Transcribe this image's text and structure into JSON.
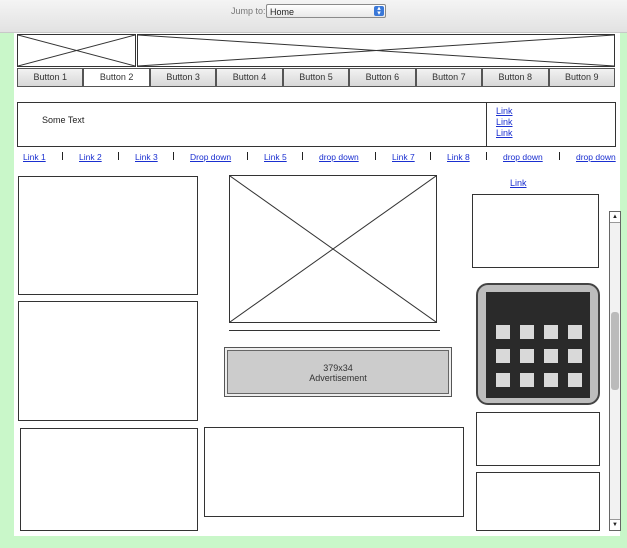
{
  "toolbar": {
    "label": "Jump to:",
    "select_value": "Home"
  },
  "nav_buttons": [
    "Button 1",
    "Button 2",
    "Button 3",
    "Button 4",
    "Button 5",
    "Button 6",
    "Button 7",
    "Button 8",
    "Button 9"
  ],
  "active_button": "Button 2",
  "info_bar": {
    "text": "Some Text",
    "links": [
      "Link",
      "Link",
      "Link"
    ]
  },
  "link_row": [
    "Link 1",
    "Link 2",
    "Link 3",
    "Drop down",
    "Link 5",
    "drop down",
    "Link 7",
    "Link 8",
    "drop down",
    "drop down"
  ],
  "right_column": {
    "link": "Link"
  },
  "advertisement": {
    "size": "379x34",
    "label": "Advertisement"
  },
  "icons": [
    "image-placeholder-icon",
    "calculator-icon",
    "scroll-up-icon",
    "scroll-down-icon",
    "select-arrow-icon"
  ]
}
